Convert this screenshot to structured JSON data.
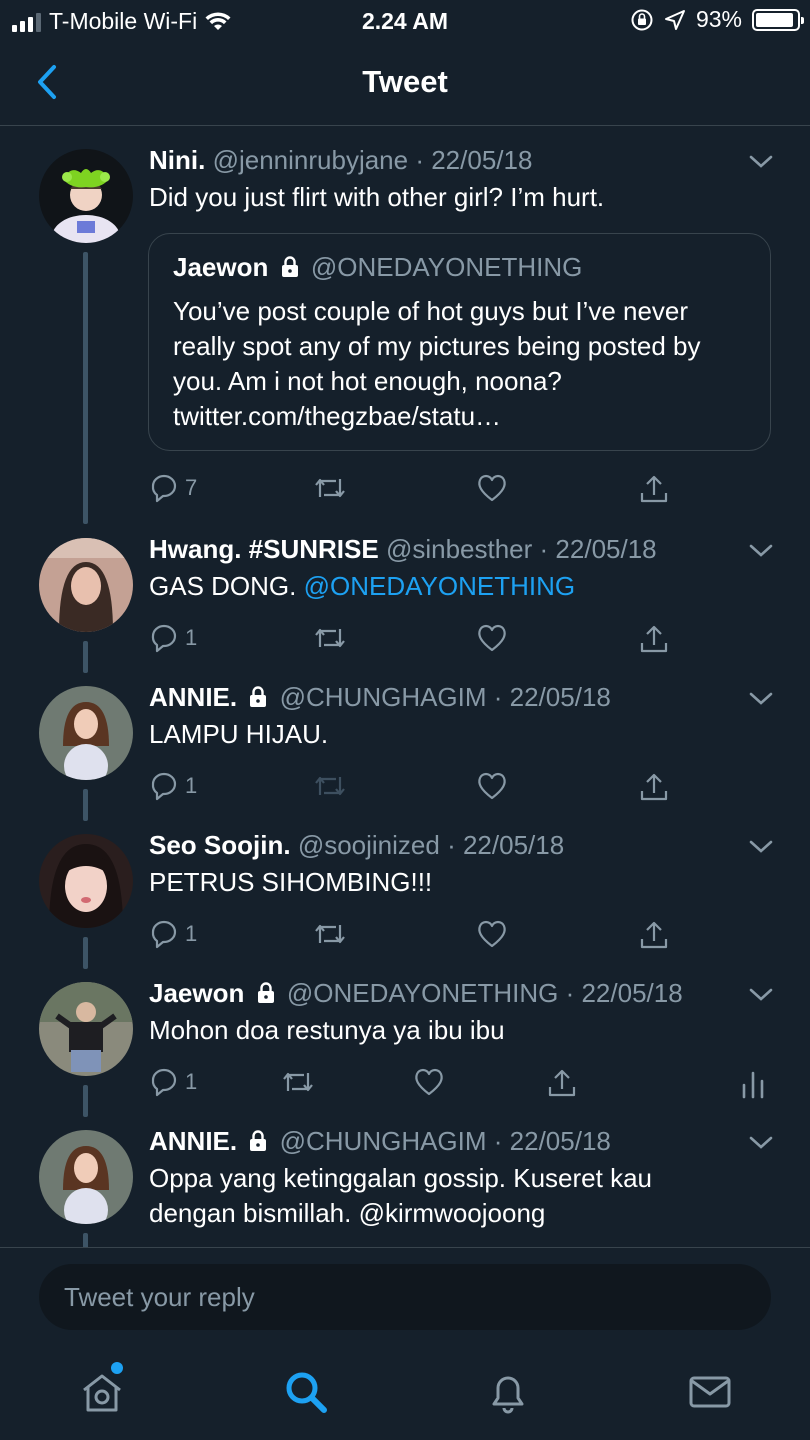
{
  "status_bar": {
    "carrier": "T-Mobile Wi-Fi",
    "time": "2.24 AM",
    "battery": "93%",
    "battery_level": 0.93
  },
  "header": {
    "title": "Tweet"
  },
  "tweets": [
    {
      "name": "Nini.",
      "handle": "@jenninrubyjane",
      "date": "· 22/05/18",
      "text": "Did you just flirt with other girl? I’m hurt.",
      "quote": {
        "name": "Jaewon",
        "handle": "@ONEDAYONETHING",
        "text": "You’ve post couple of hot guys but I’ve never really spot any of my pictures being posted by you. Am i not hot enough, noona? twitter.com/thegzbae/statu…"
      },
      "reply_count": "7"
    },
    {
      "name": "Hwang. #SUNRISE",
      "handle": "@sinbesther",
      "date": "· 22/05/18",
      "text": "GAS DONG.",
      "mention": "@ONEDAYONETHING",
      "reply_count": "1"
    },
    {
      "name": "ANNIE.",
      "handle": "@CHUNGHAGIM",
      "date": "· 22/05/18",
      "text": "LAMPU HIJAU.",
      "reply_count": "1"
    },
    {
      "name": "Seo Soojin.",
      "handle": "@soojinized",
      "date": "· 22/05/18",
      "text": "PETRUS SIHOMBING!!!",
      "reply_count": "1"
    },
    {
      "name": "Jaewon",
      "handle": "@ONEDAYONETHING",
      "date": "· 22/05/18",
      "text": "Mohon doa restunya ya ibu ibu",
      "reply_count": "1"
    },
    {
      "name": "ANNIE.",
      "handle": "@CHUNGHAGIM",
      "date": "· 22/05/18",
      "text": "Oppa yang ketinggalan gossip. Kuseret kau dengan bismillah. @kirmwoojoong"
    }
  ],
  "reply": {
    "placeholder": "Tweet your reply"
  },
  "tabbar": {
    "items": [
      "home-icon",
      "search-icon",
      "bell-icon",
      "mail-icon"
    ]
  },
  "colors": {
    "background": "#15202b",
    "accent": "#1da1f2",
    "secondary_text": "#8899a6",
    "border": "#38444d"
  }
}
